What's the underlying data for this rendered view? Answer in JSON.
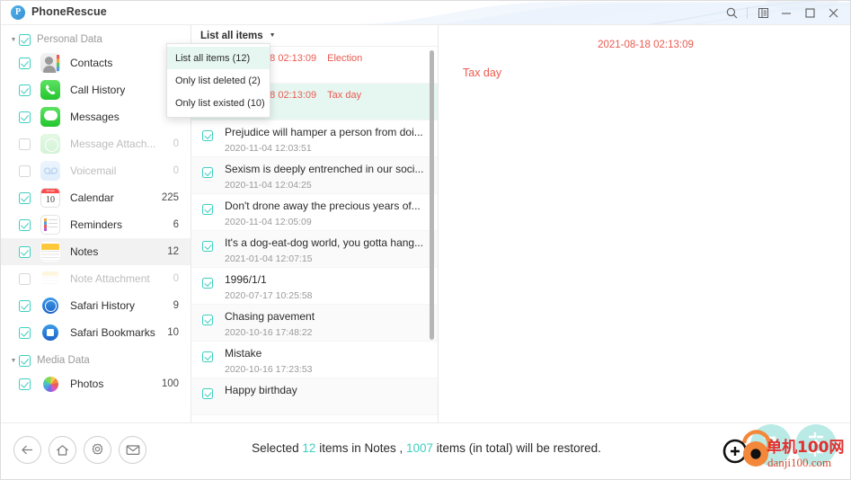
{
  "window": {
    "title": "PhoneRescue",
    "logo_letter": "P",
    "controls": [
      {
        "name": "search-icon",
        "label": "Search"
      },
      {
        "name": "panel-icon",
        "label": "Panel"
      },
      {
        "name": "minimize-button",
        "label": "Minimize"
      },
      {
        "name": "maximize-button",
        "label": "Maximize"
      },
      {
        "name": "close-button",
        "label": "Close"
      }
    ]
  },
  "sidebar": {
    "groups": [
      {
        "label": "Personal Data",
        "checked": true,
        "items": [
          {
            "label": "Contacts",
            "count": "",
            "checked": true,
            "enabled": true,
            "icon": "contacts-icon"
          },
          {
            "label": "Call History",
            "count": "",
            "checked": true,
            "enabled": true,
            "icon": "call-history-icon"
          },
          {
            "label": "Messages",
            "count": "",
            "checked": true,
            "enabled": true,
            "icon": "messages-icon"
          },
          {
            "label": "Message Attach...",
            "count": "0",
            "checked": false,
            "enabled": false,
            "icon": "message-attachment-icon"
          },
          {
            "label": "Voicemail",
            "count": "0",
            "checked": false,
            "enabled": false,
            "icon": "voicemail-icon"
          },
          {
            "label": "Calendar",
            "count": "225",
            "checked": true,
            "enabled": true,
            "icon": "calendar-icon"
          },
          {
            "label": "Reminders",
            "count": "6",
            "checked": true,
            "enabled": true,
            "icon": "reminders-icon"
          },
          {
            "label": "Notes",
            "count": "12",
            "checked": true,
            "enabled": true,
            "icon": "notes-icon",
            "selected": true
          },
          {
            "label": "Note Attachment",
            "count": "0",
            "checked": false,
            "enabled": false,
            "icon": "note-attachment-icon"
          },
          {
            "label": "Safari History",
            "count": "9",
            "checked": true,
            "enabled": true,
            "icon": "safari-history-icon"
          },
          {
            "label": "Safari Bookmarks",
            "count": "10",
            "checked": true,
            "enabled": true,
            "icon": "safari-bookmarks-icon"
          }
        ]
      },
      {
        "label": "Media Data",
        "checked": true,
        "items": [
          {
            "label": "Photos",
            "count": "100",
            "checked": true,
            "enabled": true,
            "icon": "photos-icon"
          }
        ]
      }
    ],
    "calendar_icon_day": "10",
    "calendar_icon_month": "Monday"
  },
  "list": {
    "header_label": "List all items",
    "dropdown": {
      "options": [
        {
          "label": "List all items (12)",
          "active": true
        },
        {
          "label": "Only list deleted (2)",
          "active": false
        },
        {
          "label": "Only list existed (10)",
          "active": false
        }
      ]
    },
    "items": [
      {
        "title": "Election",
        "date": "2021-08-18 02:13:09",
        "deleted": true,
        "checked": true,
        "bg": "white"
      },
      {
        "title": "Tax day",
        "date": "2021-08-18 02:13:09",
        "deleted": true,
        "checked": true,
        "bg": "mint"
      },
      {
        "title": "Prejudice will hamper a person from doi...",
        "date": "2020-11-04 12:03:51",
        "deleted": false,
        "checked": true,
        "bg": "white"
      },
      {
        "title": "Sexism is deeply entrenched in our soci...",
        "date": "2020-11-04 12:04:25",
        "deleted": false,
        "checked": true,
        "bg": "alt"
      },
      {
        "title": "Don't drone away the precious years of...",
        "date": "2020-11-04 12:05:09",
        "deleted": false,
        "checked": true,
        "bg": "white"
      },
      {
        "title": "It's a dog-eat-dog world, you gotta hang...",
        "date": "2021-01-04 12:07:15",
        "deleted": false,
        "checked": true,
        "bg": "alt"
      },
      {
        "title": "1996/1/1",
        "date": "2020-07-17 10:25:58",
        "deleted": false,
        "checked": true,
        "bg": "white"
      },
      {
        "title": "Chasing pavement",
        "date": "2020-10-16 17:48:22",
        "deleted": false,
        "checked": true,
        "bg": "alt"
      },
      {
        "title": "Mistake",
        "date": "2020-10-16 17:23:53",
        "deleted": false,
        "checked": true,
        "bg": "white"
      },
      {
        "title": "Happy birthday",
        "date": "",
        "deleted": false,
        "checked": true,
        "bg": "alt"
      }
    ]
  },
  "detail": {
    "date": "2021-08-18 02:13:09",
    "body": "Tax day"
  },
  "footer": {
    "buttons": [
      {
        "name": "back-button",
        "label": "Back"
      },
      {
        "name": "home-button",
        "label": "Home"
      },
      {
        "name": "settings-button",
        "label": "Settings"
      },
      {
        "name": "mail-button",
        "label": "Mail"
      }
    ],
    "status": {
      "prefix": "Selected ",
      "selected_count": "12",
      "middle": " items in Notes , ",
      "total_count": "1007",
      "suffix": " items (in total) will be restored."
    }
  },
  "colors": {
    "accent": "#3ecfc0",
    "deleted": "#ea5a4f",
    "selected_row": "#e6f7f2"
  },
  "watermark": {
    "text_cn": "单机100网",
    "text_url": "danji100.com"
  }
}
